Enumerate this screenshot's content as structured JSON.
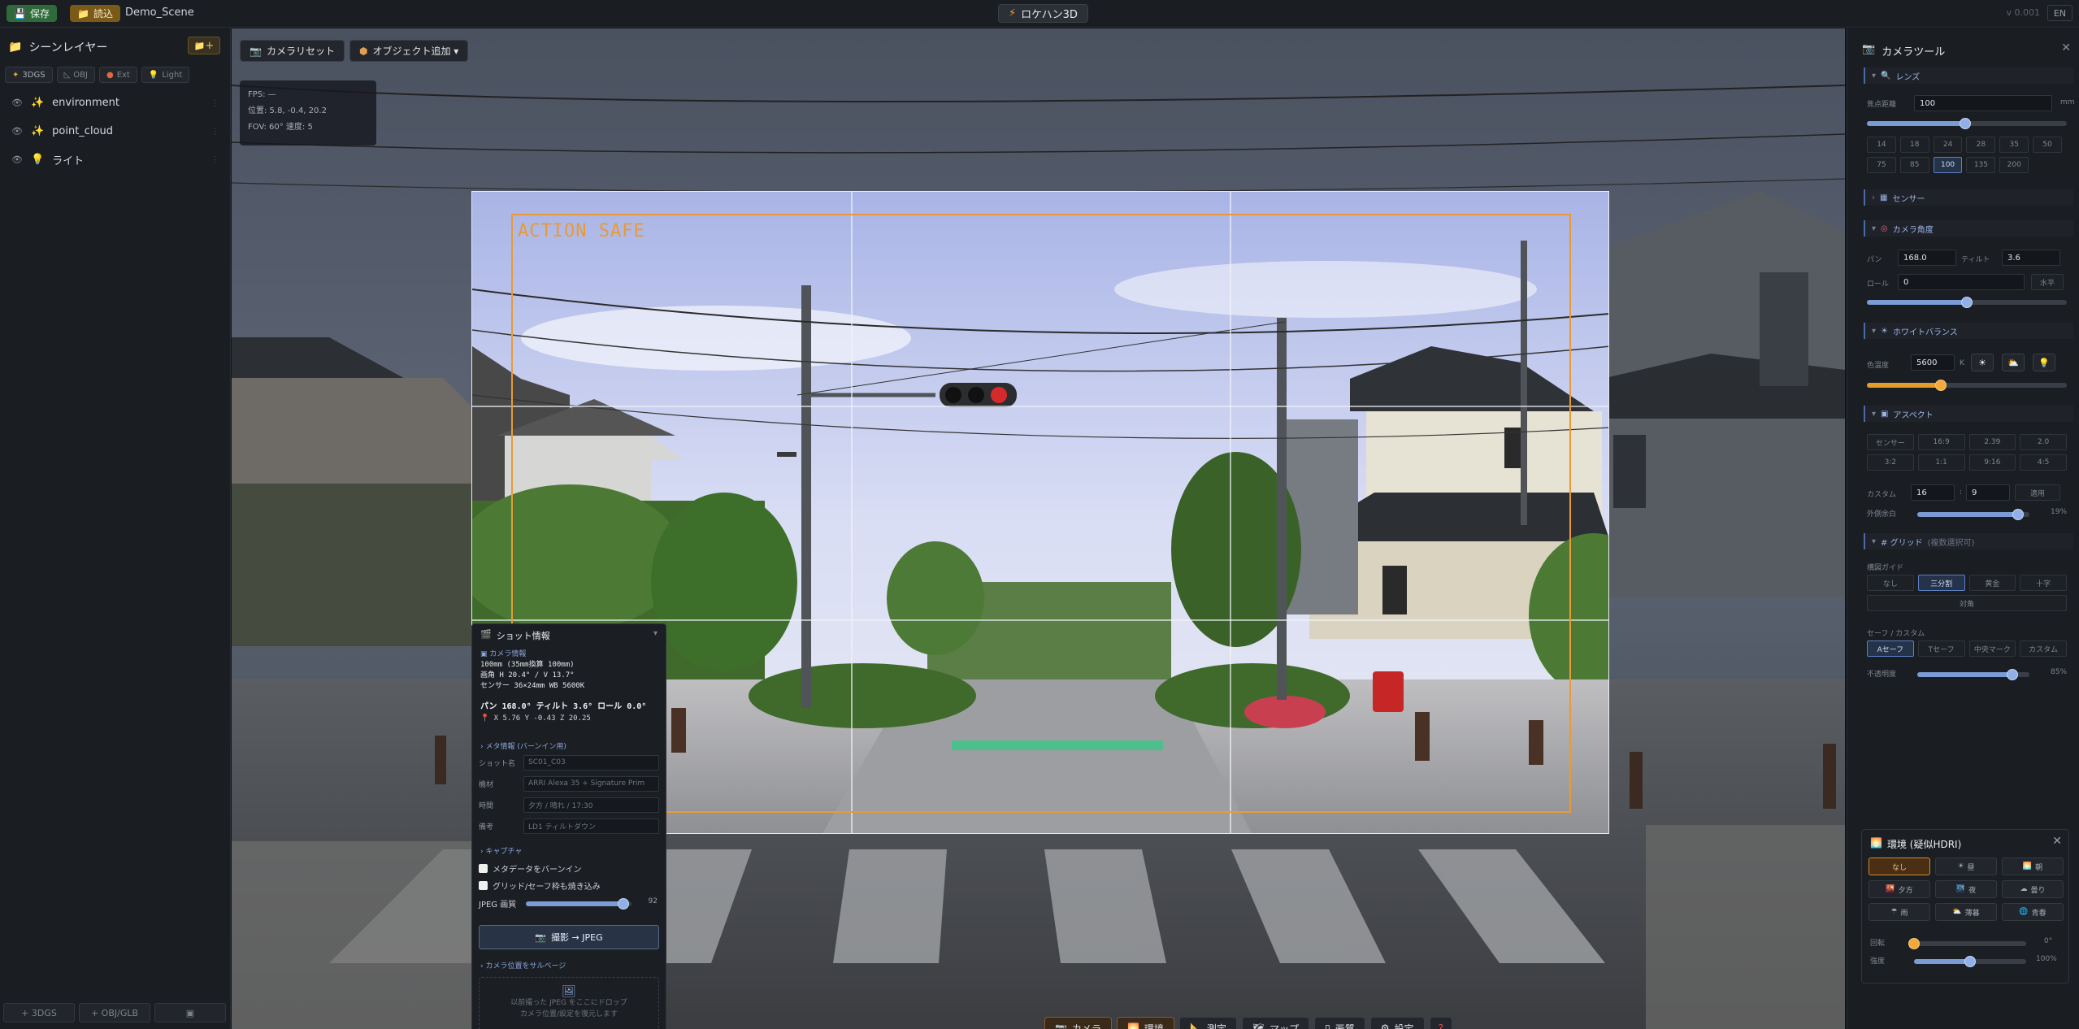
{
  "topbar": {
    "save_label": "保存",
    "load_label": "読込",
    "scene_name": "Demo_Scene",
    "app_title": "ロケハン3D",
    "version": "v 0.001",
    "lang": "EN"
  },
  "layers_panel": {
    "title": "シーンレイヤー",
    "add_label": "+",
    "filters": [
      "3DGS",
      "OBJ",
      "Ext",
      "Light"
    ],
    "items": [
      {
        "name": "environment",
        "icon": "sparkle-icon"
      },
      {
        "name": "point_cloud",
        "icon": "sparkle-icon"
      },
      {
        "name": "ライト",
        "icon": "bulb-icon"
      }
    ],
    "bottom_buttons": [
      "+ 3DGS",
      "+ OBJ/GLB",
      "▣"
    ]
  },
  "viewport": {
    "camera_reset": "カメラリセット",
    "add_object": "オブジェクト追加 ▾",
    "hud": {
      "fps": "FPS: —",
      "position": "位置: 5.8, -0.4, 20.2",
      "fov": "FOV: 60°  速度: 5"
    },
    "safe_label": "ACTION SAFE"
  },
  "shot_info": {
    "title": "ショット情報",
    "camera_section": "カメラ情報",
    "lens_line": "100mm (35mm換算 100mm)",
    "angle_line": "画角 H 20.4° / V 13.7°",
    "sensor_line": "センサー 36×24mm WB 5600K",
    "pantilt_line": "パン 168.0°  ティルト 3.6°  ロール 0.0°",
    "coords_line": "X 5.76  Y -0.43  Z 20.25",
    "meta_section": "メタ情報 (バーンイン用)",
    "fields": [
      {
        "label": "ショット名",
        "value": "SC01_C03"
      },
      {
        "label": "機材",
        "value": "ARRI Alexa 35 + Signature Prim"
      },
      {
        "label": "時間",
        "value": "夕方 / 晴れ / 17:30"
      },
      {
        "label": "備考",
        "value": "LD1 ティルトダウン"
      }
    ],
    "capture_section": "キャプチャ",
    "checkbox_meta": "メタデータをバーンイン",
    "checkbox_grid": "グリッド/セーフ枠も焼き込み",
    "jpeg_label": "JPEG 画質",
    "jpeg_value": "92",
    "jpeg_fraction": 0.92,
    "capture_button": "撮影 → JPEG",
    "restore_section": "カメラ位置をサルベージ",
    "drop_line1": "以前撮った JPEG をここにドロップ",
    "drop_line2": "カメラ位置/設定を復元します"
  },
  "bottom_toolbar": [
    {
      "label": "カメラ",
      "icon": "camera-icon",
      "active": true
    },
    {
      "label": "環境",
      "icon": "environment-icon",
      "active": true
    },
    {
      "label": "測定",
      "icon": "ruler-icon",
      "active": false
    },
    {
      "label": "マップ",
      "icon": "map-icon",
      "active": false
    },
    {
      "label": "画質",
      "icon": "quality-icon",
      "active": false
    },
    {
      "label": "設定",
      "icon": "gear-icon",
      "active": false
    },
    {
      "label": "?",
      "icon": "help-icon",
      "active": false
    }
  ],
  "camera_tool": {
    "title": "カメラツール",
    "lens": {
      "section": "レンズ",
      "focal_label": "焦点距離",
      "focal_value": "100",
      "focal_unit": "mm",
      "focal_fraction": 0.49,
      "presets": [
        "14",
        "18",
        "24",
        "28",
        "35",
        "50",
        "75",
        "85",
        "100",
        "135",
        "200"
      ],
      "selected": "100"
    },
    "sensor_section": "センサー",
    "angle": {
      "section": "カメラ角度",
      "pan_label": "パン",
      "pan_value": "168.0",
      "tilt_label": "ティルト",
      "tilt_value": "3.6",
      "roll_label": "ロール",
      "roll_value": "0",
      "level_label": "水平",
      "roll_fraction": 0.5
    },
    "wb": {
      "section": "ホワイトバランス",
      "temp_label": "色温度",
      "temp_value": "5600",
      "temp_unit": "K",
      "temp_fraction": 0.37
    },
    "aspect": {
      "section": "アスペクト",
      "options": [
        "センサー",
        "16:9",
        "2.39",
        "2.0",
        "3:2",
        "1:1",
        "9:16",
        "4:5"
      ],
      "custom_label": "カスタム",
      "custom_w": "16",
      "custom_h": "9",
      "apply_label": "適用",
      "outer_label": "外側余白",
      "outer_value": "19%",
      "outer_fraction": 0.9
    },
    "grid": {
      "section": "# グリッド",
      "section_note": "(複数選択可)",
      "composition_label": "構図ガイド",
      "composition": [
        "なし",
        "三分割",
        "黄金",
        "十字"
      ],
      "composition_selected": "三分割",
      "diagonal": "対角",
      "safe_label": "セーフ / カスタム",
      "safe_options": [
        "Aセーフ",
        "Tセーフ",
        "中央マーク",
        "カスタム"
      ],
      "safe_selected": "Aセーフ",
      "opacity_label": "不透明度",
      "opacity_value": "85%",
      "opacity_fraction": 0.85
    }
  },
  "environment": {
    "title": "環境 (疑似HDRI)",
    "options": [
      {
        "label": "なし",
        "icon": ""
      },
      {
        "label": "昼",
        "icon": "sun-icon"
      },
      {
        "label": "朝",
        "icon": "sunrise-icon"
      },
      {
        "label": "夕方",
        "icon": "sunset-icon"
      },
      {
        "label": "夜",
        "icon": "night-icon"
      },
      {
        "label": "曇り",
        "icon": "cloud-icon"
      },
      {
        "label": "雨",
        "icon": "rain-icon"
      },
      {
        "label": "薄暮",
        "icon": "dusk-icon"
      },
      {
        "label": "青春",
        "icon": "sky-icon"
      }
    ],
    "selected": "なし",
    "rotation_label": "回転",
    "rotation_value": "0°",
    "rotation_fraction": 0.0,
    "intensity_label": "強度",
    "intensity_value": "100%",
    "intensity_fraction": 0.5
  }
}
